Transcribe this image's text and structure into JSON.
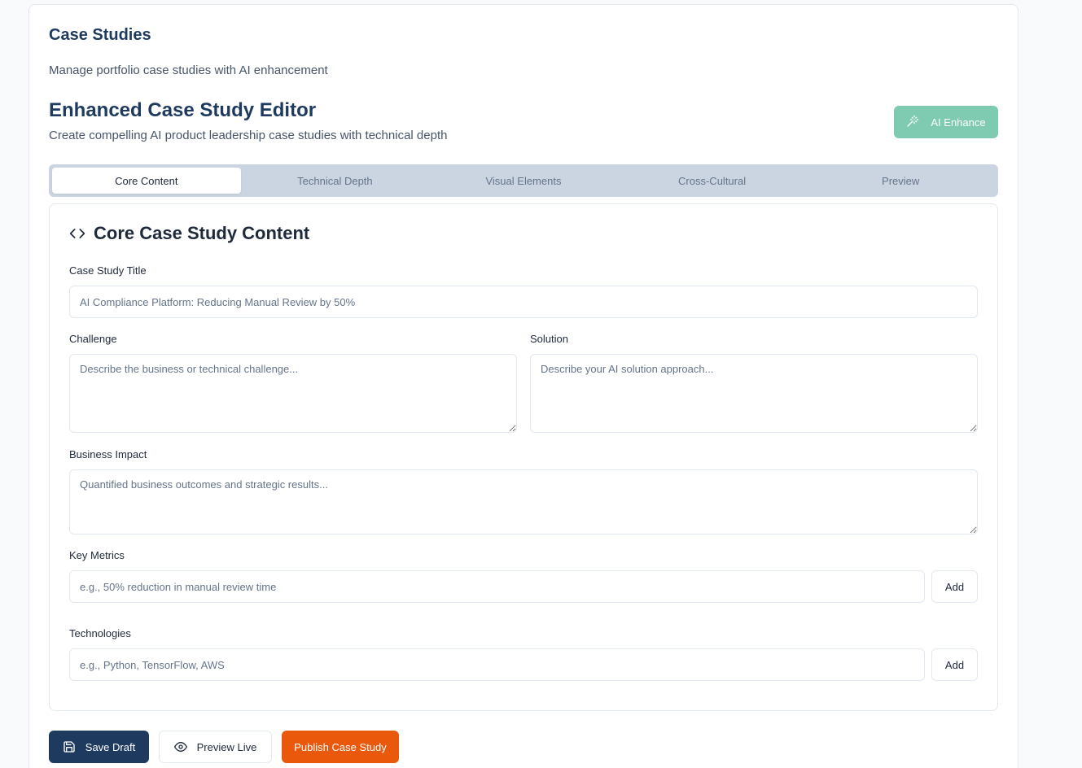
{
  "page": {
    "title": "Case Studies",
    "subtitle": "Manage portfolio case studies with AI enhancement"
  },
  "editor": {
    "title": "Enhanced Case Study Editor",
    "subtitle": "Create compelling AI product leadership case studies with technical depth",
    "ai_enhance_label": "AI Enhance",
    "ai_enhance_icon": "magic-wand-icon"
  },
  "tabs": [
    {
      "label": "Core Content",
      "active": true
    },
    {
      "label": "Technical Depth",
      "active": false
    },
    {
      "label": "Visual Elements",
      "active": false
    },
    {
      "label": "Cross-Cultural",
      "active": false
    },
    {
      "label": "Preview",
      "active": false
    }
  ],
  "section": {
    "icon": "code-icon",
    "heading": "Core Case Study Content"
  },
  "form": {
    "title_label": "Case Study Title",
    "title_placeholder": "AI Compliance Platform: Reducing Manual Review by 50%",
    "challenge_label": "Challenge",
    "challenge_placeholder": "Describe the business or technical challenge...",
    "solution_label": "Solution",
    "solution_placeholder": "Describe your AI solution approach...",
    "impact_label": "Business Impact",
    "impact_placeholder": "Quantified business outcomes and strategic results...",
    "metrics_label": "Key Metrics",
    "metrics_placeholder": "e.g., 50% reduction in manual review time",
    "metrics_add": "Add",
    "tech_label": "Technologies",
    "tech_placeholder": "e.g., Python, TensorFlow, AWS",
    "tech_add": "Add"
  },
  "actions": {
    "save_label": "Save Draft",
    "preview_label": "Preview Live",
    "publish_label": "Publish Case Study"
  },
  "colors": {
    "brand_navy": "#1e3a5f",
    "accent_teal": "#7fcbb2",
    "publish_orange": "#ea580c"
  }
}
